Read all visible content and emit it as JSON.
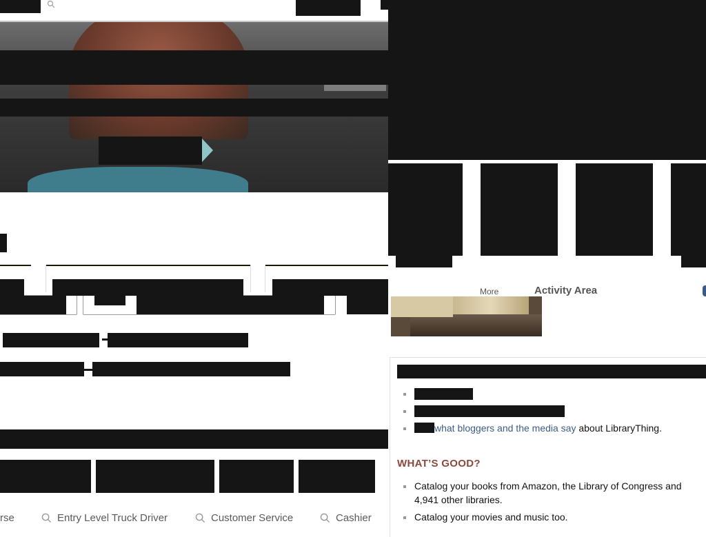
{
  "header": {
    "search_icon": "search-icon"
  },
  "sidebar_right": {
    "more_label": "More",
    "activity_label": "Activity Area"
  },
  "info_panel": {
    "bullet_link": "what bloggers and the media say",
    "bullet_suffix": " about LibraryThing.",
    "section_heading": "WHAT’S GOOD?",
    "good_items": [
      "Catalog your books from Amazon, the Library of Congress and 4,941 other libraries.",
      "Catalog your movies and music too."
    ]
  },
  "suggestions": [
    {
      "label": "rse",
      "icon": "search-icon"
    },
    {
      "label": "Entry Level Truck Driver",
      "icon": "search-icon"
    },
    {
      "label": "Customer Service",
      "icon": "search-icon"
    },
    {
      "label": "Cashier",
      "icon": "search-icon"
    }
  ],
  "colors": {
    "redaction": "#151515",
    "link": "#3a5c8a",
    "heading_accent": "#8b4a3c",
    "hero_arrow": "#8fc5c6"
  }
}
